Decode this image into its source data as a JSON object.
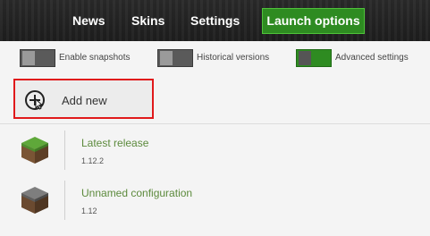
{
  "nav": {
    "items": [
      {
        "label": "News"
      },
      {
        "label": "Skins"
      },
      {
        "label": "Settings"
      }
    ],
    "active": {
      "label": "Launch options"
    }
  },
  "options": {
    "snapshots": {
      "label": "Enable snapshots",
      "on": false
    },
    "historical": {
      "label": "Historical versions",
      "on": false
    },
    "advanced": {
      "label": "Advanced settings",
      "on": true
    }
  },
  "add_new": {
    "label": "Add new",
    "icon": "add-icon"
  },
  "configurations": [
    {
      "name": "Latest release",
      "version": "1.12.2",
      "icon": "grass-block-icon"
    },
    {
      "name": "Unnamed configuration",
      "version": "1.12",
      "icon": "dirt-block-icon"
    }
  ],
  "colors": {
    "accent": "#2e8b21",
    "highlight_border": "#e0191b",
    "config_name": "#5c8a3c"
  }
}
